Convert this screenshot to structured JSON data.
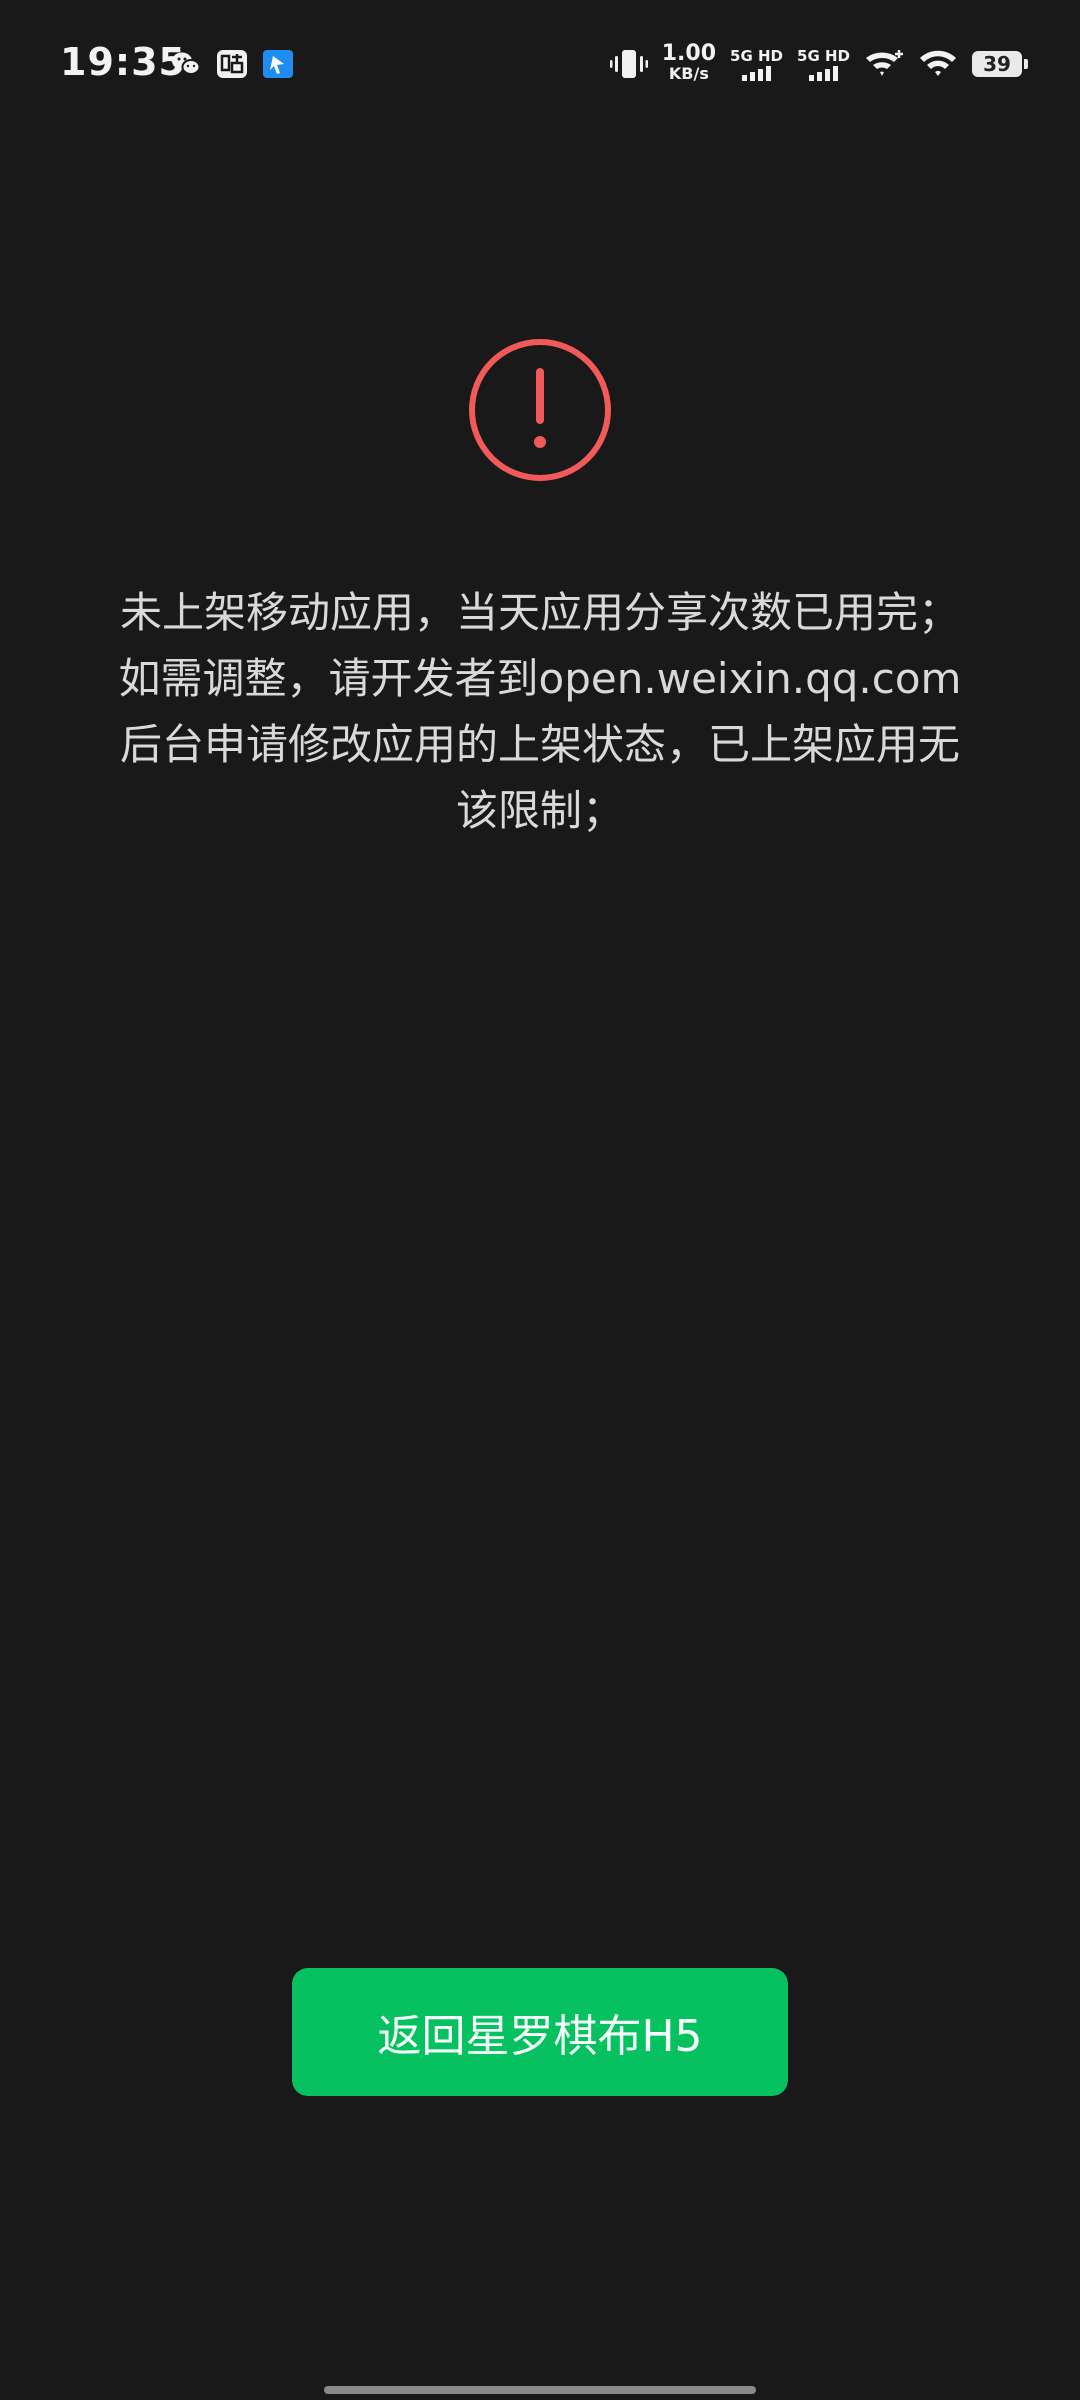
{
  "status_bar": {
    "time": "19:35",
    "net_speed_value": "1.00",
    "net_speed_unit": "KB/s",
    "sim1_label": "5G HD",
    "sim2_label": "5G HD",
    "battery_level": "39",
    "icons": [
      "wechat-icon",
      "tieba-icon",
      "app-notification-icon",
      "vibrate-icon",
      "wifi-plus-icon",
      "wifi-icon"
    ]
  },
  "alert": {
    "icon": "exclamation-circle-icon",
    "accent_color": "#f25a5a",
    "message": "未上架移动应用，当天应用分享次数已用完；如需调整，请开发者到open.weixin.qq.com后台申请修改应用的上架状态，已上架应用无该限制；"
  },
  "action": {
    "return_label": "返回星罗棋布H5",
    "color": "#07c160"
  }
}
